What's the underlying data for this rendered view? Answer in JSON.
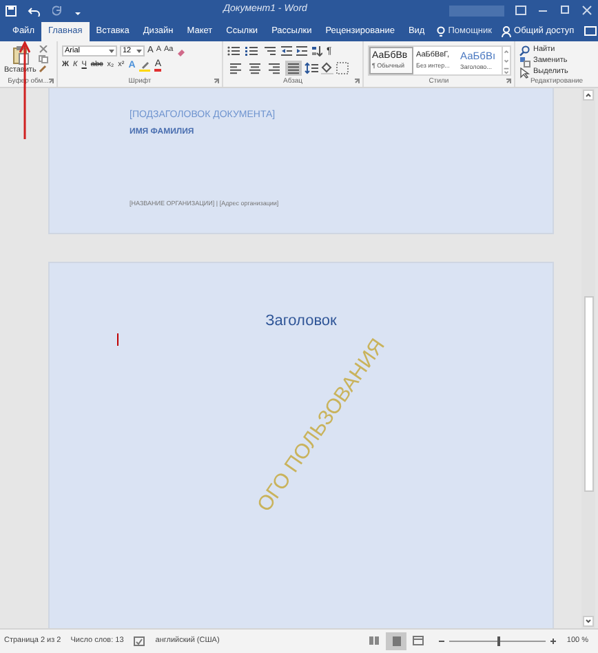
{
  "window": {
    "title": "Документ1 - Word"
  },
  "tabs": [
    {
      "label": "Файл",
      "selected": false
    },
    {
      "label": "Главная",
      "selected": true
    },
    {
      "label": "Вставка",
      "selected": false
    },
    {
      "label": "Дизайн",
      "selected": false
    },
    {
      "label": "Макет",
      "selected": false
    },
    {
      "label": "Ссылки",
      "selected": false
    },
    {
      "label": "Рассылки",
      "selected": false
    },
    {
      "label": "Рецензирование",
      "selected": false
    },
    {
      "label": "Вид",
      "selected": false
    }
  ],
  "assistant": {
    "label": "Помощник"
  },
  "share": {
    "label": "Общий доступ"
  },
  "ribbon": {
    "clipboard": {
      "paste_label": "Вставить",
      "group_label": "Буфер обм..."
    },
    "font": {
      "font_name": "Arial",
      "font_size": "12",
      "size_buttons": [
        "A",
        "A"
      ],
      "case_label": "Aa",
      "format_buttons": [
        "Ж",
        "К",
        "Ч",
        "abc",
        "x₂",
        "x²"
      ],
      "effects_label": "A",
      "color_label": "A",
      "group_label": "Шрифт"
    },
    "paragraph": {
      "show_marks_label": "¶",
      "alignments": [
        {
          "kind": "left",
          "selected": false
        },
        {
          "kind": "center",
          "selected": false
        },
        {
          "kind": "right",
          "selected": false
        },
        {
          "kind": "justify",
          "selected": true
        }
      ],
      "group_label": "Абзац"
    },
    "styles": {
      "items": [
        {
          "sample": "АаБбВв",
          "name": "¶ Обычный",
          "kind": "normal",
          "selected": true
        },
        {
          "sample": "АаБбВвГ,",
          "name": "Без интер...",
          "kind": "normal",
          "selected": false
        },
        {
          "sample": "АаБбВı",
          "name": "Заголово...",
          "kind": "heading",
          "selected": false
        }
      ],
      "group_label": "Стили"
    },
    "editing": {
      "items": [
        {
          "label": "Найти",
          "kind": "find"
        },
        {
          "label": "Заменить",
          "kind": "replace"
        },
        {
          "label": "Выделить",
          "kind": "select"
        }
      ],
      "group_label": "Редактирование"
    }
  },
  "document": {
    "page_1": {
      "subtitle": "[ПОДЗАГОЛОВОК ДОКУМЕНТА]",
      "author": "ИМЯ ФАМИЛИЯ",
      "organization": "[НАЗВАНИЕ ОРГАНИЗАЦИИ] | [Адрес организации]"
    },
    "page_2": {
      "heading": "Заголовок",
      "watermark": "ОГО ПОЛЬЗОВАНИЯ"
    }
  },
  "status_bar": {
    "page": "Страница 2 из 2",
    "words": "Число слов: 13",
    "language": "английский (США)",
    "views": [
      {
        "kind": "read",
        "selected": false
      },
      {
        "kind": "print",
        "selected": true
      },
      {
        "kind": "web",
        "selected": false
      }
    ],
    "zoom": {
      "level": 0.5,
      "reading": "100 %"
    }
  }
}
